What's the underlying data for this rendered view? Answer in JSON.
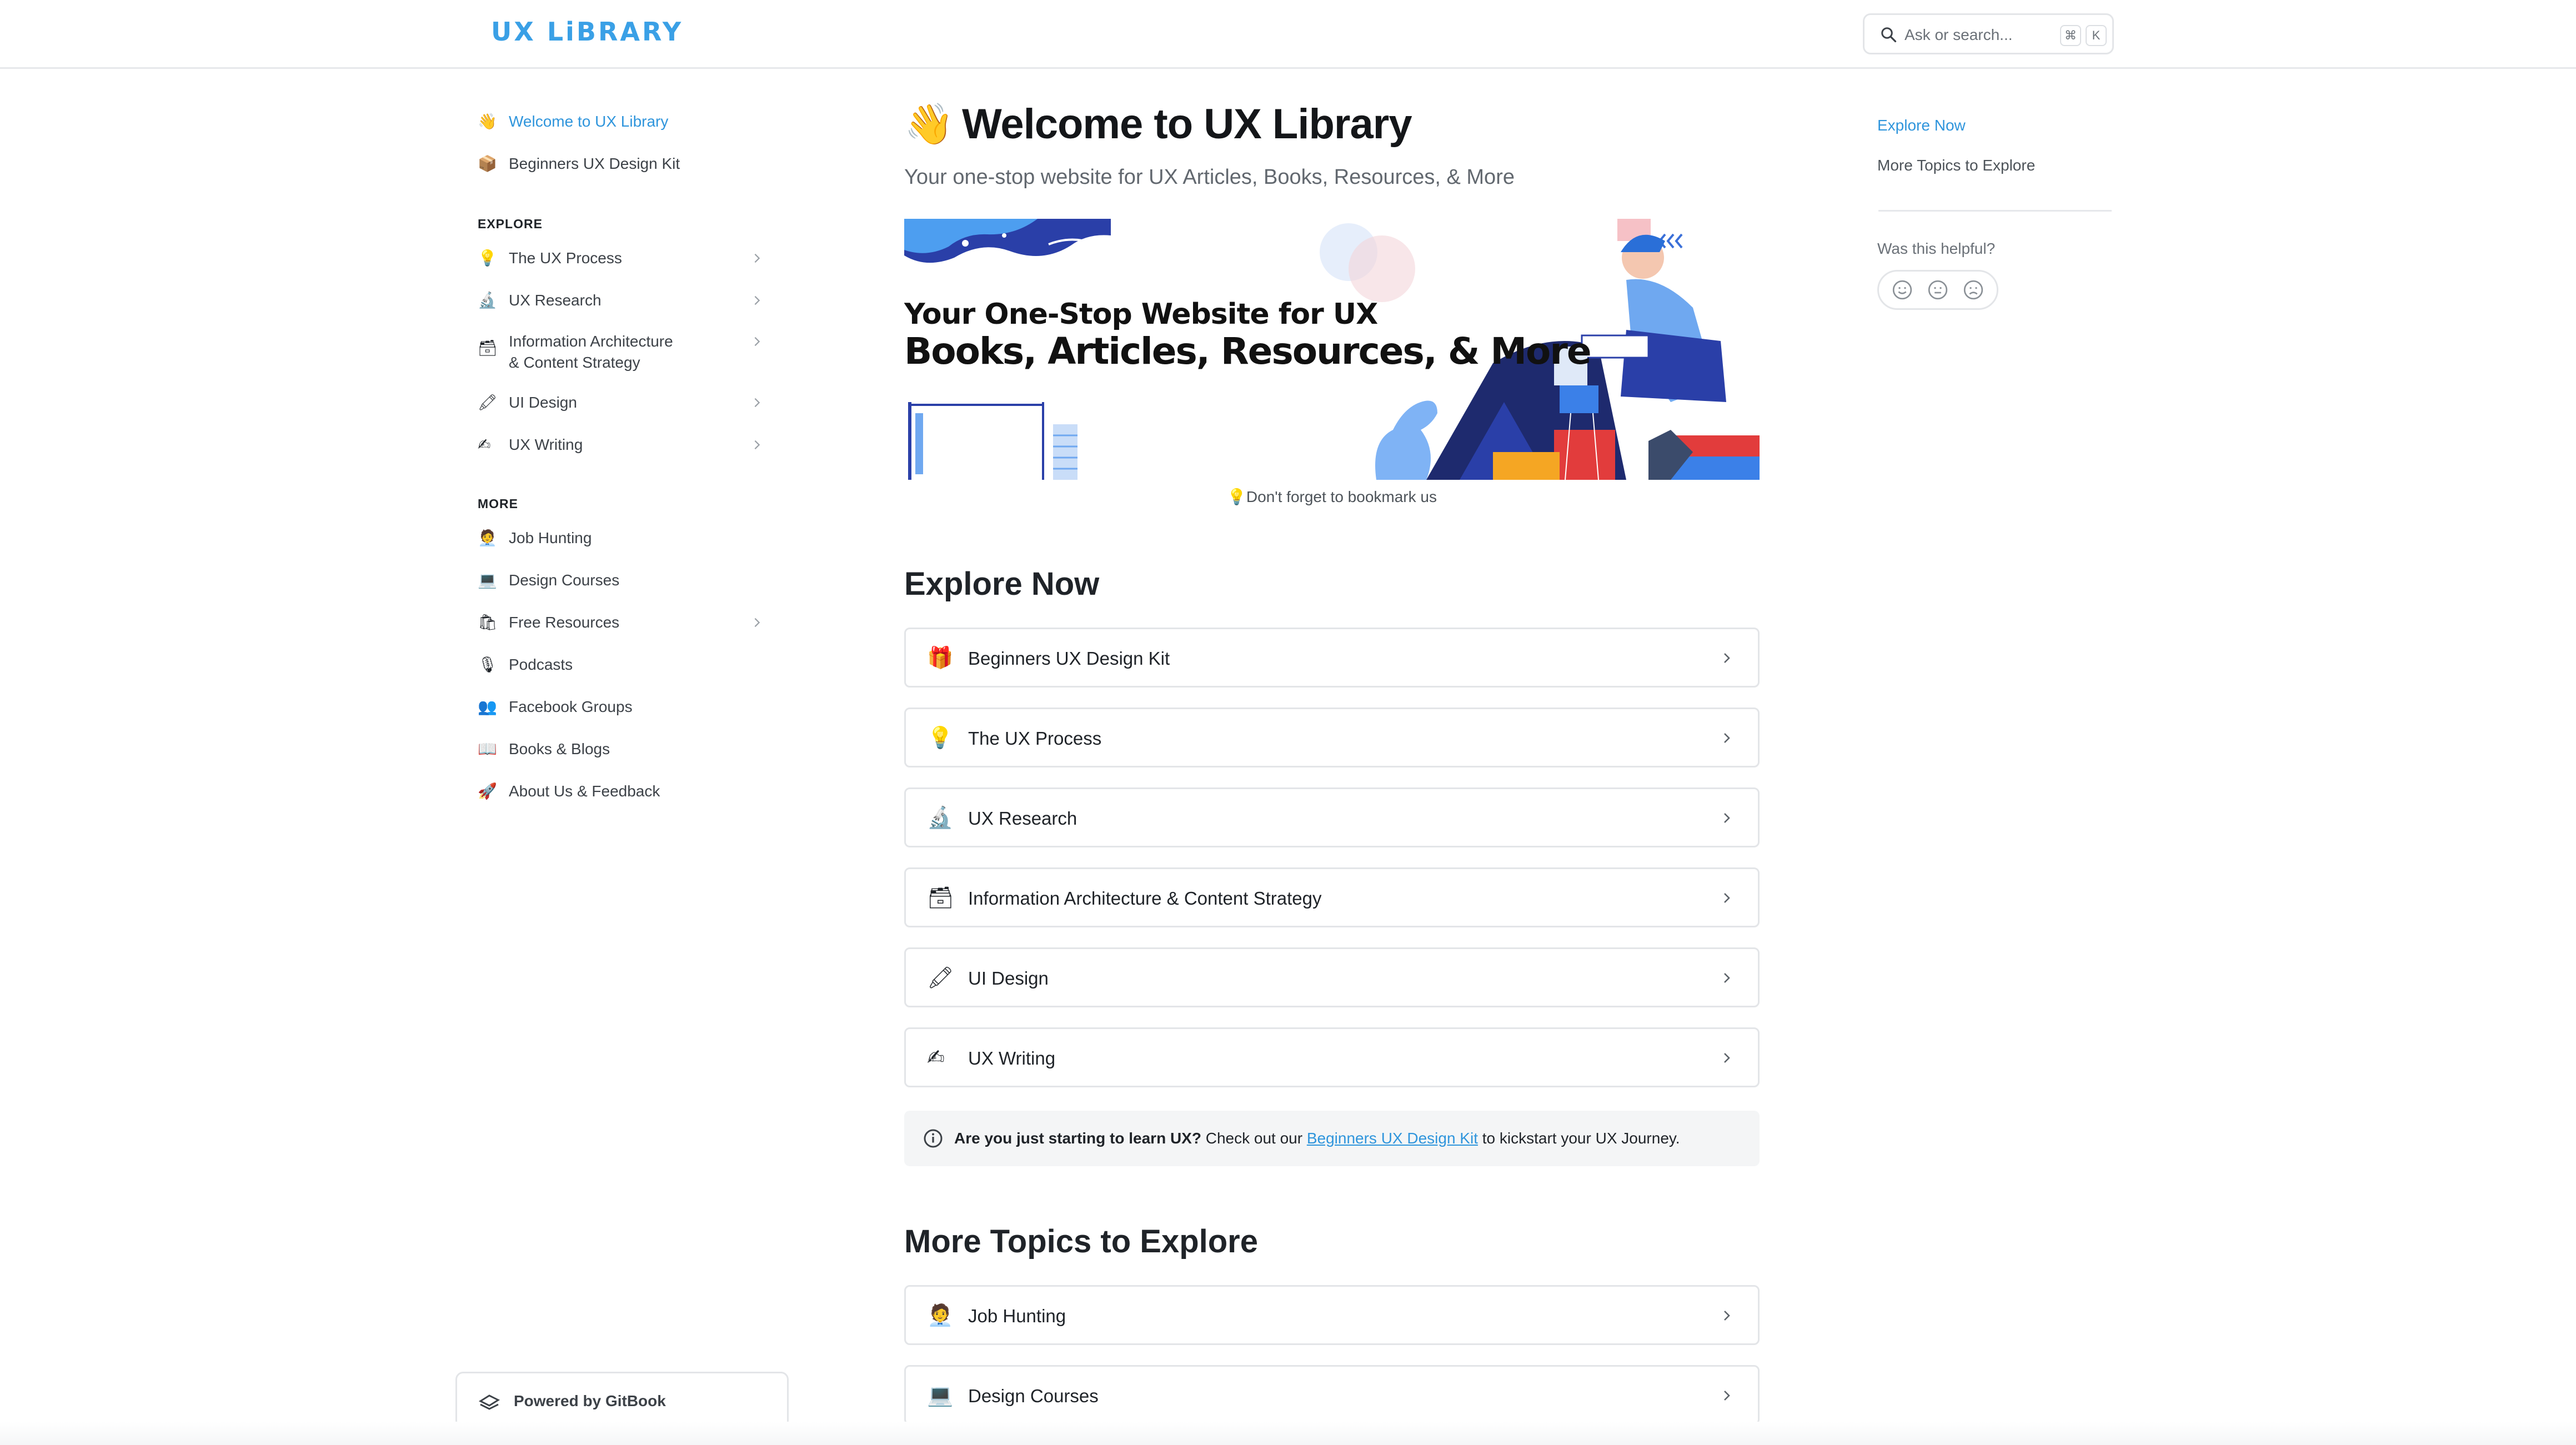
{
  "header": {
    "logo": "UX LiBRARY",
    "search_placeholder": "Ask or search...",
    "shortcut_keys": [
      "⌘",
      "K"
    ]
  },
  "sidebar": {
    "top_items": [
      {
        "icon": "👋",
        "label": "Welcome to UX Library",
        "active": true
      },
      {
        "icon": "📦",
        "label": "Beginners UX Design Kit",
        "active": false
      }
    ],
    "explore_heading": "EXPLORE",
    "explore_items": [
      {
        "icon": "💡",
        "label": "The UX Process",
        "has_children": true
      },
      {
        "icon": "🔬",
        "label": "UX Research",
        "has_children": true
      },
      {
        "icon": "🗃",
        "label": "Information Architecture & Content Strategy",
        "label_line1": "Information Architecture",
        "label_line2": "& Content Strategy",
        "has_children": true
      },
      {
        "icon": "🖍",
        "label": "UI Design",
        "has_children": true
      },
      {
        "icon": "✍",
        "label": "UX Writing",
        "has_children": true
      }
    ],
    "more_heading": "MORE",
    "more_items": [
      {
        "icon": "🧑‍💼",
        "label": "Job Hunting",
        "has_children": false
      },
      {
        "icon": "💻",
        "label": "Design Courses",
        "has_children": false
      },
      {
        "icon": "🛍",
        "label": "Free Resources",
        "has_children": true
      },
      {
        "icon": "🎙",
        "label": "Podcasts",
        "has_children": false
      },
      {
        "icon": "👥",
        "label": "Facebook Groups",
        "has_children": false
      },
      {
        "icon": "📖",
        "label": "Books & Blogs",
        "has_children": false
      },
      {
        "icon": "🚀",
        "label": "About Us & Feedback",
        "has_children": false
      }
    ],
    "powered_by": "Powered by GitBook"
  },
  "main": {
    "title_icon": "👋",
    "title": "Welcome to UX Library",
    "subtitle": "Your one-stop website for UX Articles, Books, Resources, & More",
    "banner": {
      "line1": "Your One-Stop Website for UX",
      "line2": "Books, Articles, Resources, & More"
    },
    "bookmark_note": "💡Don't forget to bookmark us",
    "explore_heading": "Explore Now",
    "explore_cards": [
      {
        "icon": "🎁",
        "label": "Beginners UX Design Kit"
      },
      {
        "icon": "💡",
        "label": "The UX Process"
      },
      {
        "icon": "🔬",
        "label": "UX Research"
      },
      {
        "icon": "🗃",
        "label": "Information Architecture & Content Strategy"
      },
      {
        "icon": "🖍",
        "label": "UI Design"
      },
      {
        "icon": "✍",
        "label": "UX Writing"
      }
    ],
    "hint": {
      "bold": "Are you just starting to learn UX?",
      "before_link": " Check out our ",
      "link": "Beginners UX Design Kit",
      "after_link": " to kickstart your UX Journey."
    },
    "more_heading": "More Topics to Explore",
    "more_cards": [
      {
        "icon": "🧑‍💼",
        "label": "Job Hunting"
      },
      {
        "icon": "💻",
        "label": "Design Courses"
      }
    ]
  },
  "toc": {
    "items": [
      {
        "label": "Explore Now",
        "active": true
      },
      {
        "label": "More Topics to Explore",
        "active": false
      }
    ],
    "helpful_label": "Was this helpful?"
  },
  "colors": {
    "accent": "#2f95dc",
    "logo": "#3aa0e6",
    "border": "#e3e5e8",
    "hint_bg": "#f4f5f6"
  }
}
